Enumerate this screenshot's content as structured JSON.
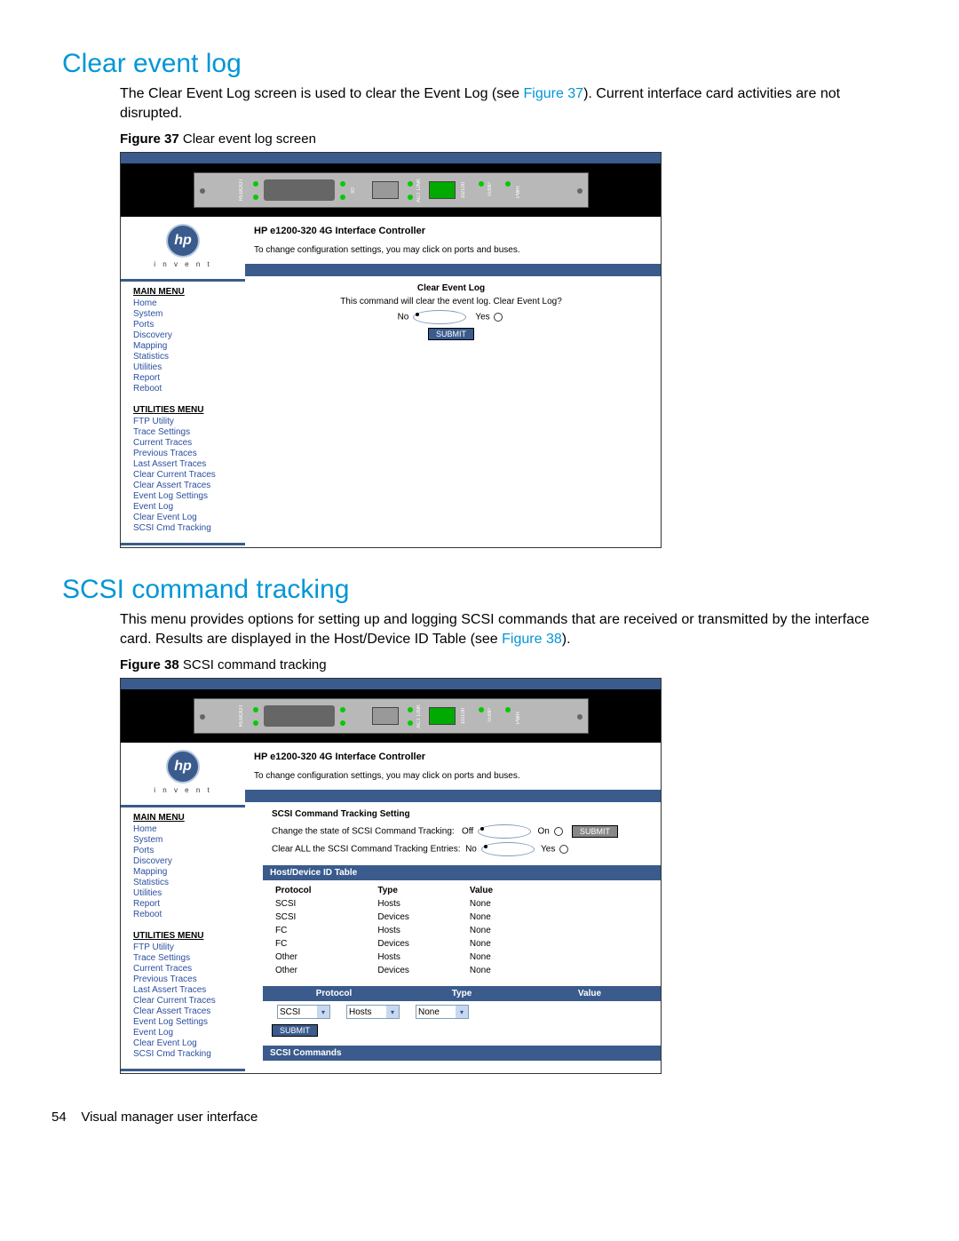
{
  "sections": {
    "s1": {
      "title": "Clear event log",
      "body_pre": "The Clear Event Log screen is used to clear the Event Log (see ",
      "body_link": "Figure 37",
      "body_post": "). Current interface card activities are not disrupted.",
      "fig_label": "Figure 37",
      "fig_caption": " Clear event log screen"
    },
    "s2": {
      "title": "SCSI command tracking",
      "body_pre": "This menu provides options for setting up and logging SCSI commands that are received or transmitted by the interface card. Results are displayed in the Host/Device ID Table (see ",
      "body_link": "Figure 38",
      "body_post": ").",
      "fig_label": "Figure 38",
      "fig_caption": " SCSI command tracking"
    }
  },
  "screenshots": {
    "common": {
      "product_title": "HP e1200-320 4G Interface Controller",
      "product_sub": "To change configuration settings, you may click on ports and buses.",
      "logo_text": "hp",
      "invent": "i n v e n t",
      "main_menu_hdr": "MAIN MENU",
      "main_menu": [
        "Home",
        "System",
        "Ports",
        "Discovery",
        "Mapping",
        "Statistics",
        "Utilities",
        "Report",
        "Reboot"
      ],
      "util_menu_hdr": "UTILITIES MENU",
      "util_menu": [
        "FTP Utility",
        "Trace Settings",
        "Current Traces",
        "Previous Traces",
        "Last Assert Traces",
        "Clear Current Traces",
        "Clear Assert Traces",
        "Event Log Settings",
        "Event Log",
        "Clear Event Log",
        "SCSI Cmd Tracking"
      ]
    },
    "fig37": {
      "panel_title": "Clear Event Log",
      "prompt": "This command will clear the event log. Clear Event Log?",
      "opt_no": "No",
      "opt_yes": "Yes",
      "submit": "SUBMIT"
    },
    "fig38": {
      "sect_title": "SCSI Command Tracking Setting",
      "line1_label": "Change the state of SCSI Command Tracking:",
      "off": "Off",
      "on": "On",
      "submit": "SUBMIT",
      "line2_label": "Clear ALL the SCSI Command Tracking Entries:",
      "no": "No",
      "yes": "Yes",
      "table_hdr": "Host/Device ID Table",
      "cols": [
        "Protocol",
        "Type",
        "Value"
      ],
      "rows": [
        [
          "SCSI",
          "Hosts",
          "None"
        ],
        [
          "SCSI",
          "Devices",
          "None"
        ],
        [
          "FC",
          "Hosts",
          "None"
        ],
        [
          "FC",
          "Devices",
          "None"
        ],
        [
          "Other",
          "Hosts",
          "None"
        ],
        [
          "Other",
          "Devices",
          "None"
        ]
      ],
      "sel_protocol": "SCSI",
      "sel_type": "Hosts",
      "sel_value": "None",
      "submit2": "SUBMIT",
      "cmds_hdr": "SCSI Commands"
    }
  },
  "footer": {
    "page_num": "54",
    "title": "Visual manager user interface"
  }
}
